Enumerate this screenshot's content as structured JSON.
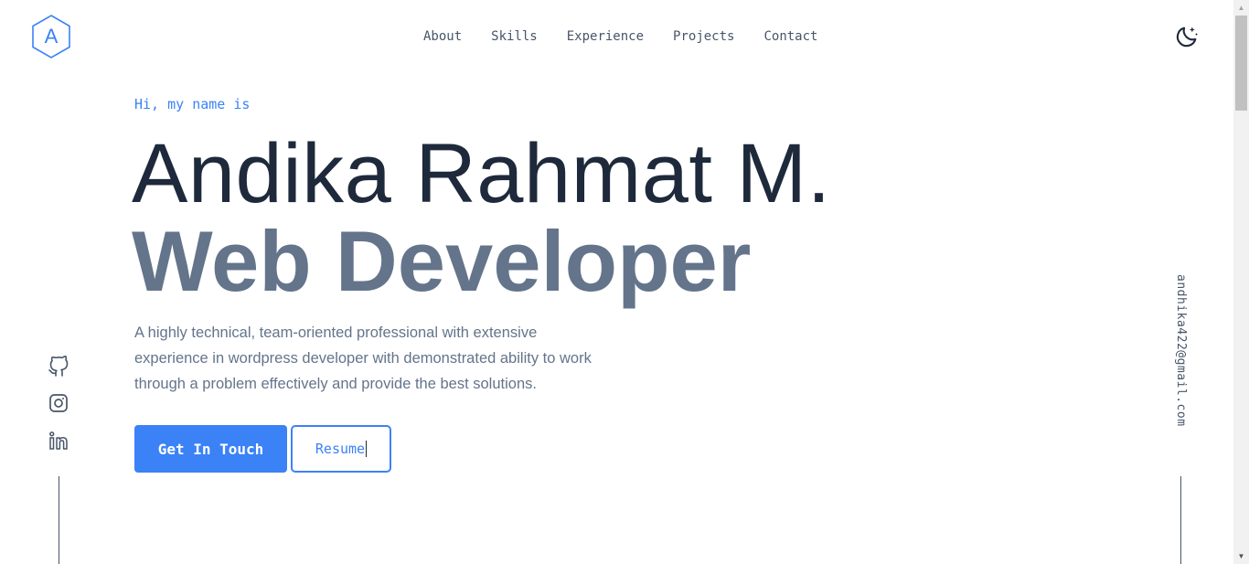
{
  "logo": {
    "letter": "A",
    "icon": "hexagon-logo-icon",
    "color": "#3b82f6"
  },
  "nav": {
    "items": [
      {
        "label": "About"
      },
      {
        "label": "Skills"
      },
      {
        "label": "Experience"
      },
      {
        "label": "Projects"
      },
      {
        "label": "Contact"
      }
    ]
  },
  "theme_toggle": {
    "icon": "moon-stars-icon"
  },
  "hero": {
    "greeting": "Hi, my name is",
    "name": "Andika Rahmat M.",
    "role": "Web Developer",
    "description": "A highly technical, team-oriented professional with extensive experience in wordpress developer with demonstrated ability to work through a problem effectively and provide the best solutions.",
    "primary_button": "Get In Touch",
    "secondary_button": "Resume"
  },
  "social": {
    "icons": [
      "github-icon",
      "instagram-icon",
      "linkedin-icon"
    ]
  },
  "email": "andhika422@gmail.com",
  "colors": {
    "accent": "#3b82f6",
    "heading": "#1e293b",
    "muted": "#64748b"
  }
}
